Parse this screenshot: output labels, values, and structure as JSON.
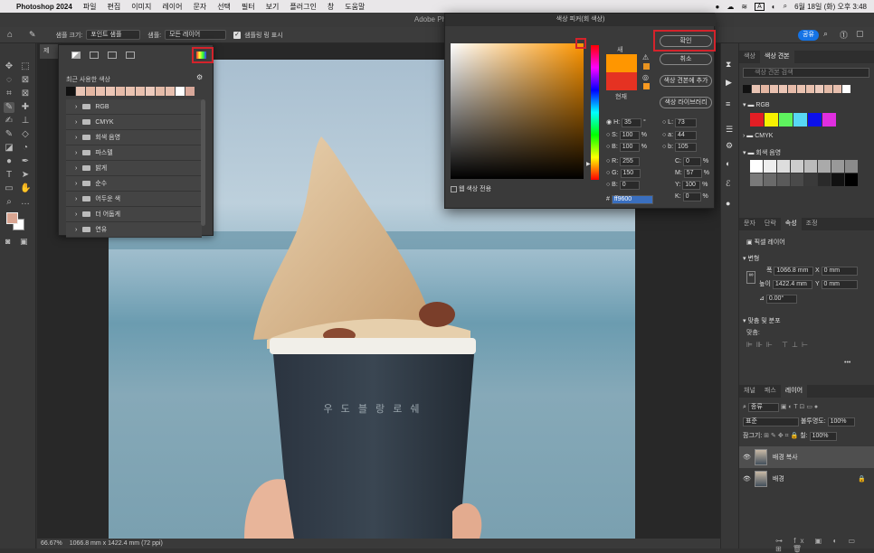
{
  "menubar": {
    "app": "Photoshop 2024",
    "items": [
      "파일",
      "편집",
      "이미지",
      "레이어",
      "문자",
      "선택",
      "필터",
      "보기",
      "플러그인",
      "창",
      "도움말"
    ],
    "datetime": "6월 18일 (화) 오후 3:48",
    "input_source": "A"
  },
  "window": {
    "title": "Adobe Photos"
  },
  "options": {
    "sample_size_label": "샘플 크기:",
    "sample_size_value": "포인트 샘플",
    "sample_label": "샘플:",
    "sample_value": "모든 레이어",
    "show_ring_label": "샘플링 링 표시",
    "share": "공유"
  },
  "document_tab": "제",
  "swatches_popup": {
    "recent_label": "최근 사용한 색상",
    "recent_colors": [
      "#111111",
      "#e8c4b4",
      "#e3b6a2",
      "#e9c1b0",
      "#ecc6b6",
      "#e6bba9",
      "#eac3b1",
      "#e8c0ae",
      "#edcbbd",
      "#e4bba8",
      "#e7bfae",
      "#ffffff",
      "#d8a89a"
    ],
    "groups": [
      "RGB",
      "CMYK",
      "회색 음영",
      "파스텔",
      "밝게",
      "순수",
      "어두운 색",
      "더 어둡게",
      "연유"
    ]
  },
  "color_picker": {
    "title": "색상 피커(회 색상)",
    "ok": "확인",
    "cancel": "취소",
    "add_swatch": "색상 견본에 추가",
    "libraries": "색상 라이브러리",
    "new_label": "새",
    "current_label": "현재",
    "new_color": "#ff9600",
    "current_color": "#e53222",
    "web_only": "웹 색상 전용",
    "H": "35",
    "H_unit": "°",
    "S": "100",
    "S_unit": "%",
    "B": "100",
    "B_unit": "%",
    "R": "255",
    "G": "150",
    "Bv": "0",
    "L": "73",
    "a": "44",
    "b": "105",
    "C": "0",
    "M": "57",
    "Y": "100",
    "K": "0",
    "pct": "%",
    "hex": "ff9600",
    "hash": "#"
  },
  "right_panel": {
    "tabs_top": [
      "색상",
      "색상 견본"
    ],
    "search_placeholder": "색상 견본 검색",
    "recent_colors": [
      "#111111",
      "#e8c4b4",
      "#e3b6a2",
      "#e9c1b0",
      "#ecc6b6",
      "#e6bba9",
      "#eac3b1",
      "#e8c0ae",
      "#edcbbd",
      "#e4bba8",
      "#e7bfae",
      "#ffffff"
    ],
    "rgb_group": "RGB",
    "rgb_colors": [
      "#e31e24",
      "#f7f100",
      "#5ef25e",
      "#57d7f4",
      "#0c10ea",
      "#e02ee0"
    ],
    "cmyk_group": "CMYK",
    "gray_group": "회색 음영",
    "gray_colors": [
      "#ffffff",
      "#eeeeee",
      "#dddddd",
      "#cccccc",
      "#bbbbbb",
      "#aaaaaa",
      "#999999",
      "#8a8a8a",
      "#7a7a7a",
      "#6a6a6a",
      "#5a5a5a",
      "#4a4a4a",
      "#3a3a3a",
      "#2a2a2a",
      "#111111",
      "#000000"
    ],
    "tabs_mid": [
      "문자",
      "단락",
      "속성",
      "조정"
    ],
    "pixel_layer": "픽셀 레이어",
    "transform": "변형",
    "width_label": "폭",
    "width_value": "1066.8 mm",
    "x_label": "X",
    "x_value": "0 mm",
    "height_label": "높이",
    "height_value": "1422.4 mm",
    "y_label": "Y",
    "y_value": "0 mm",
    "angle": "0.00°",
    "align_label": "맞춤 및 분포",
    "align_sub": "맞춤:",
    "more": "•••",
    "tabs_bottom": [
      "채널",
      "패스",
      "레이어"
    ],
    "layer_kind": "종류",
    "blend_mode": "표준",
    "opacity_label": "불투명도:",
    "opacity_value": "100%",
    "lock_label": "잠그기:",
    "fill_label": "칠:",
    "fill_value": "100%",
    "layers": [
      "배경 복사",
      "배경"
    ]
  },
  "canvas": {
    "cup_text": "우 도 블 랑 로 쉐"
  },
  "status": {
    "zoom": "66.67%",
    "doc_size": "1066.8 mm x 1422.4 mm (72 ppi)"
  }
}
